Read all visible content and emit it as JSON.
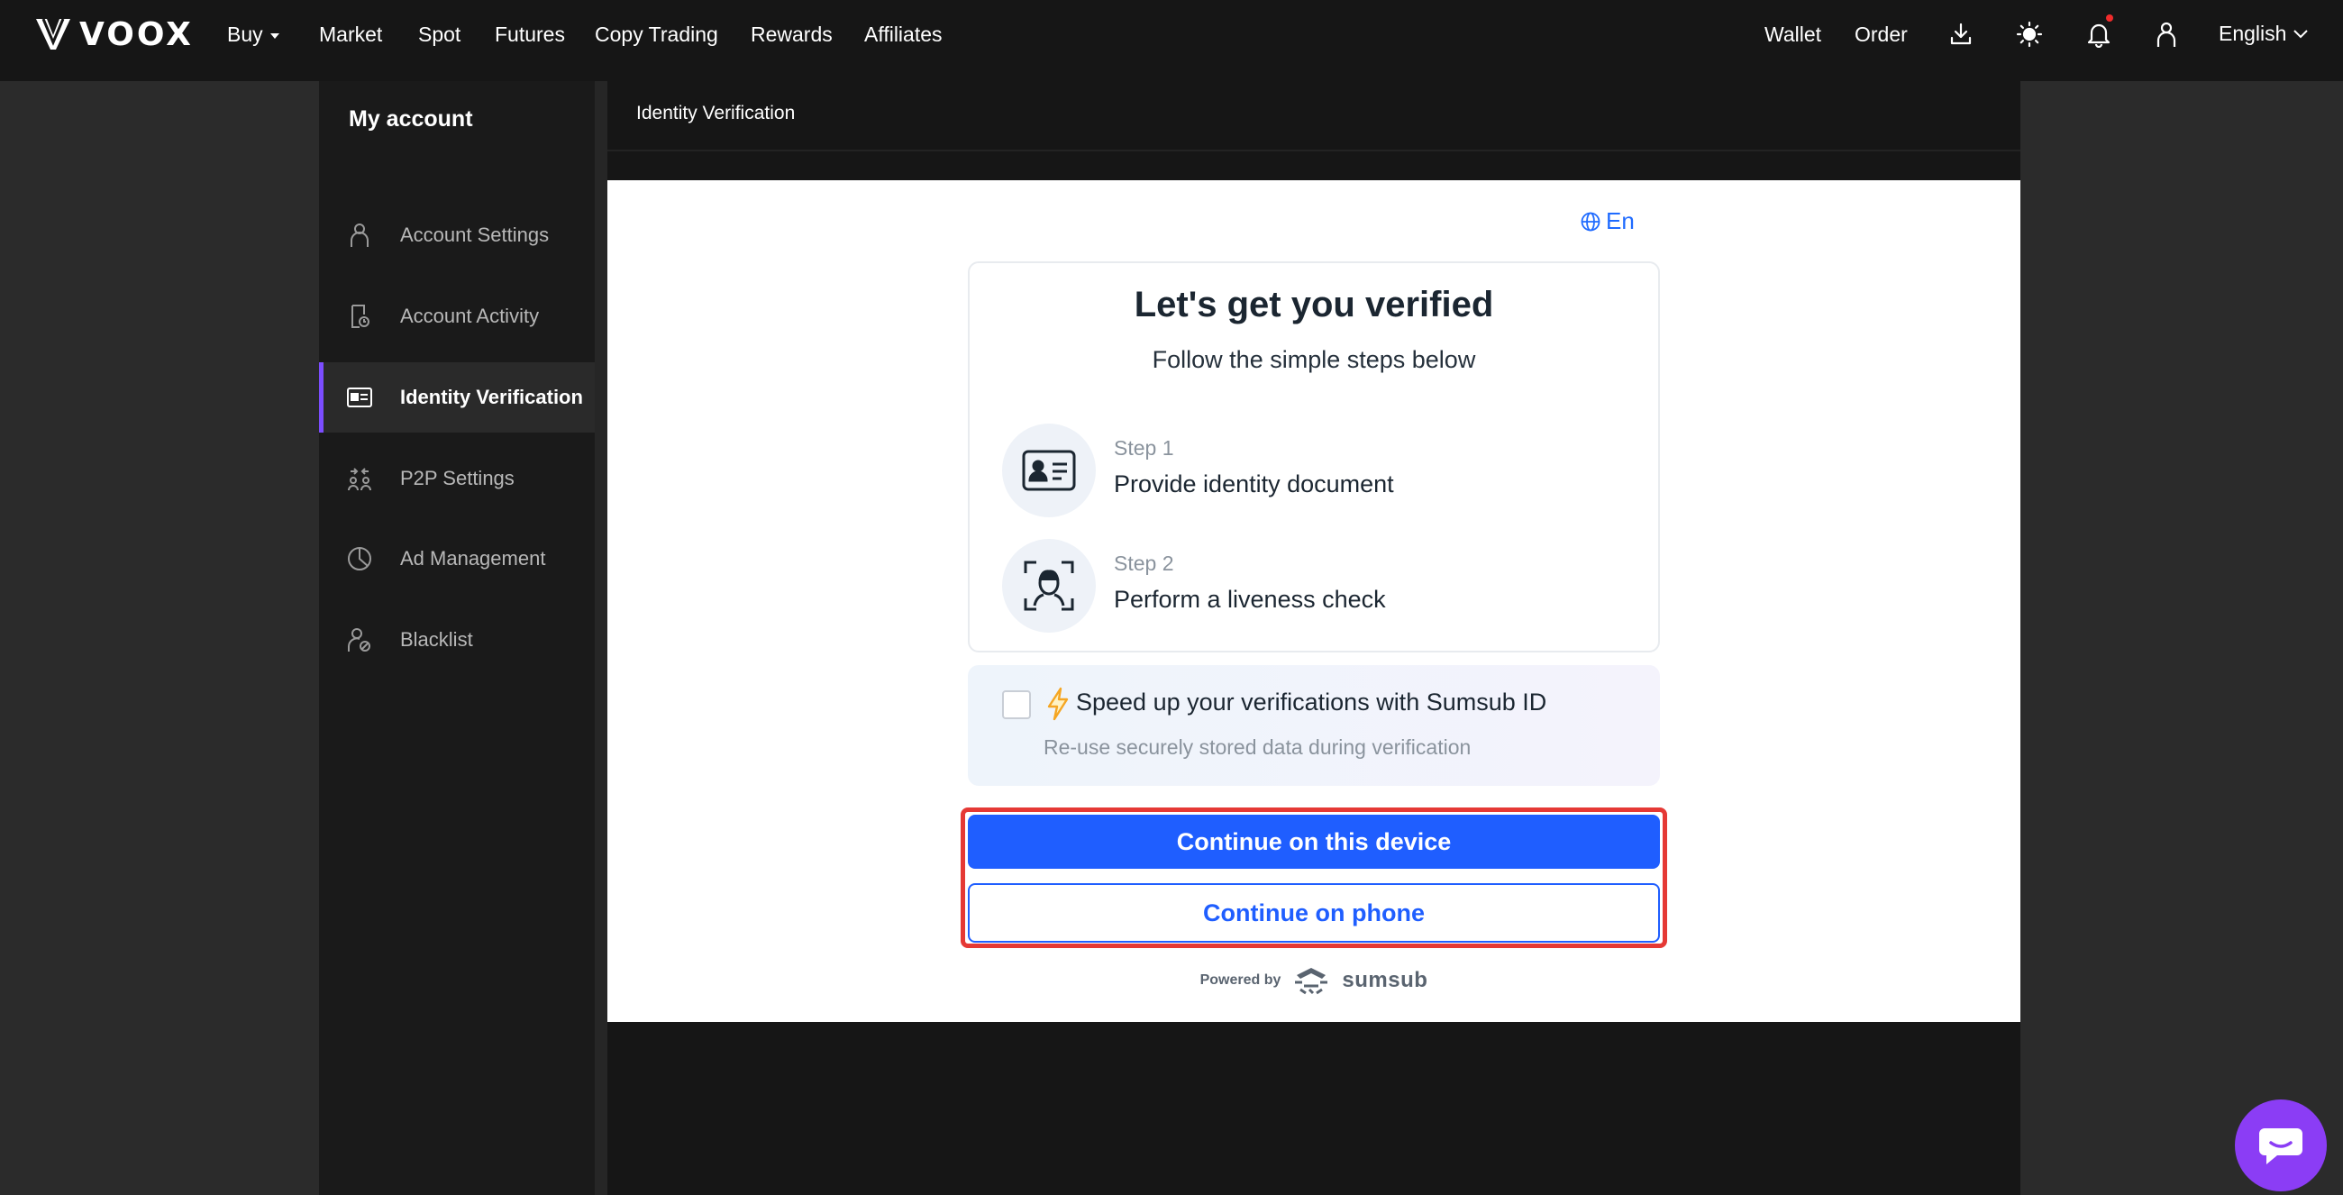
{
  "nav": {
    "logo_text": "VOOX",
    "items": [
      {
        "label": "Buy",
        "dropdown": true
      },
      {
        "label": "Market"
      },
      {
        "label": "Spot"
      },
      {
        "label": "Futures"
      },
      {
        "label": "Copy Trading"
      },
      {
        "label": "Rewards"
      },
      {
        "label": "Affiliates"
      }
    ],
    "right": {
      "wallet": "Wallet",
      "order": "Order",
      "language": "English",
      "icons": [
        "download-icon",
        "theme-sun-icon",
        "bell-icon",
        "user-icon"
      ]
    }
  },
  "sidebar": {
    "title": "My account",
    "items": [
      {
        "label": "Account Settings",
        "icon": "user-icon",
        "active": false
      },
      {
        "label": "Account Activity",
        "icon": "activity-log-icon",
        "active": false
      },
      {
        "label": "Identity Verification",
        "icon": "id-card-icon",
        "active": true
      },
      {
        "label": "P2P Settings",
        "icon": "p2p-icon",
        "active": false
      },
      {
        "label": "Ad Management",
        "icon": "pie-chart-icon",
        "active": false
      },
      {
        "label": "Blacklist",
        "icon": "user-block-icon",
        "active": false
      }
    ]
  },
  "main": {
    "breadcrumb": "Identity Verification"
  },
  "verification": {
    "language": "En",
    "title": "Let's get you verified",
    "subtitle": "Follow the simple steps below",
    "steps": [
      {
        "number": "Step 1",
        "text": "Provide identity document",
        "icon": "id-document-icon"
      },
      {
        "number": "Step 2",
        "text": "Perform a liveness check",
        "icon": "face-scan-icon"
      }
    ],
    "speedup": {
      "title": "Speed up your verifications with Sumsub ID",
      "description": "Re-use securely stored data during verification",
      "checked": false
    },
    "primary_button": "Continue on this device",
    "secondary_button": "Continue on phone",
    "powered_by": "Powered by",
    "brand": "sumsub"
  },
  "colors": {
    "accent_purple": "#7c4dff",
    "primary_blue": "#1f5eff",
    "highlight_red": "#e53935",
    "chat_purple": "#8b3df5"
  }
}
